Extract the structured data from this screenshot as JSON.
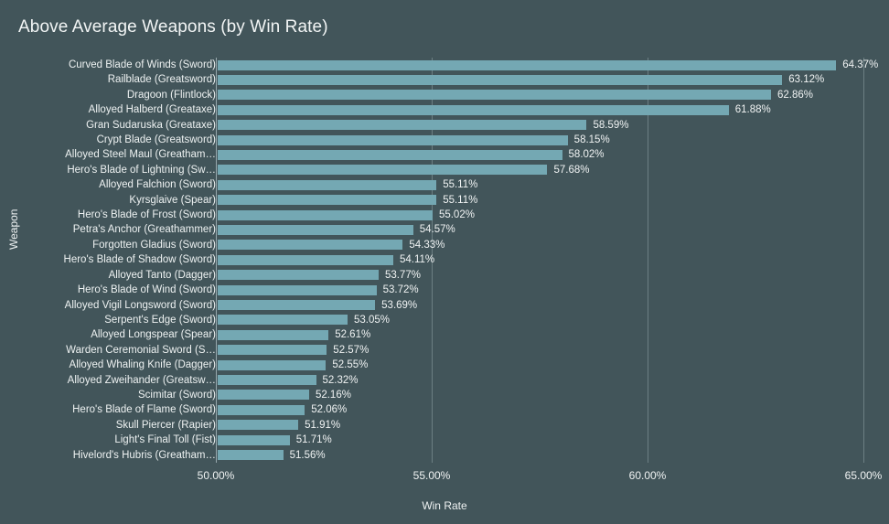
{
  "chart_data": {
    "type": "bar",
    "orientation": "horizontal",
    "title": "Above Average Weapons (by Win Rate)",
    "xlabel": "Win Rate",
    "ylabel": "Weapon",
    "xlim": [
      50.0,
      65.0
    ],
    "xticks": [
      50.0,
      55.0,
      60.0,
      65.0
    ],
    "xtick_labels": [
      "50.00%",
      "55.00%",
      "60.00%",
      "65.00%"
    ],
    "grid": true,
    "legend": null,
    "bar_color": "#74a8b3",
    "background_color": "#42555a",
    "text_color": "#eef2f2",
    "categories": [
      "Curved Blade of Winds (Sword)",
      "Railblade (Greatsword)",
      "Dragoon (Flintlock)",
      "Alloyed Halberd (Greataxe)",
      "Gran Sudaruska (Greataxe)",
      "Crypt Blade (Greatsword)",
      "Alloyed Steel Maul (Greathammer)",
      "Hero's Blade of Lightning (Sword)",
      "Alloyed Falchion (Sword)",
      "Kyrsglaive (Spear)",
      "Hero's Blade of Frost (Sword)",
      "Petra's Anchor (Greathammer)",
      "Forgotten Gladius (Sword)",
      "Hero's Blade of Shadow (Sword)",
      "Alloyed Tanto (Dagger)",
      "Hero's Blade of Wind (Sword)",
      "Alloyed Vigil Longsword (Sword)",
      "Serpent's Edge (Sword)",
      "Alloyed Longspear (Spear)",
      "Warden Ceremonial Sword (Sword)",
      "Alloyed Whaling Knife (Dagger)",
      "Alloyed Zweihander (Greatsword)",
      "Scimitar (Sword)",
      "Hero's Blade of Flame (Sword)",
      "Skull Piercer (Rapier)",
      "Light's Final Toll (Fist)",
      "Hivelord's Hubris (Greathammer)"
    ],
    "category_display_labels": [
      "Curved Blade of Winds (Sword)",
      "Railblade (Greatsword)",
      "Dragoon (Flintlock)",
      "Alloyed Halberd (Greataxe)",
      "Gran Sudaruska (Greataxe)",
      "Crypt Blade (Greatsword)",
      "Alloyed Steel Maul (Greatham…",
      "Hero's Blade of Lightning (Sw…",
      "Alloyed Falchion (Sword)",
      "Kyrsglaive (Spear)",
      "Hero's Blade of Frost (Sword)",
      "Petra's Anchor (Greathammer)",
      "Forgotten Gladius (Sword)",
      "Hero's Blade of Shadow (Sword)",
      "Alloyed Tanto (Dagger)",
      "Hero's Blade of Wind (Sword)",
      "Alloyed Vigil Longsword (Sword)",
      "Serpent's Edge (Sword)",
      "Alloyed Longspear (Spear)",
      "Warden Ceremonial Sword (S…",
      "Alloyed Whaling Knife (Dagger)",
      "Alloyed Zweihander (Greatsw…",
      "Scimitar (Sword)",
      "Hero's Blade of Flame (Sword)",
      "Skull Piercer (Rapier)",
      "Light's Final Toll (Fist)",
      "Hivelord's Hubris (Greatham…"
    ],
    "values": [
      64.37,
      63.12,
      62.86,
      61.88,
      58.59,
      58.15,
      58.02,
      57.68,
      55.11,
      55.11,
      55.02,
      54.57,
      54.33,
      54.11,
      53.77,
      53.72,
      53.69,
      53.05,
      52.61,
      52.57,
      52.55,
      52.32,
      52.16,
      52.06,
      51.91,
      51.71,
      51.56
    ],
    "value_labels": [
      "64.37%",
      "63.12%",
      "62.86%",
      "61.88%",
      "58.59%",
      "58.15%",
      "58.02%",
      "57.68%",
      "55.11%",
      "55.11%",
      "55.02%",
      "54.57%",
      "54.33%",
      "54.11%",
      "53.77%",
      "53.72%",
      "53.69%",
      "53.05%",
      "52.61%",
      "52.57%",
      "52.55%",
      "52.32%",
      "52.16%",
      "52.06%",
      "51.91%",
      "51.71%",
      "51.56%"
    ]
  }
}
